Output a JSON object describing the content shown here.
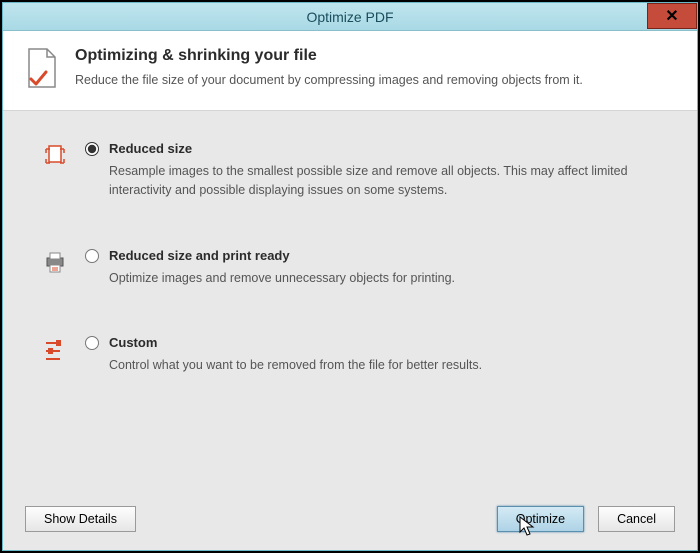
{
  "window": {
    "title": "Optimize PDF"
  },
  "header": {
    "heading": "Optimizing & shrinking your file",
    "sub": "Reduce the file size of your document by compressing images and removing objects from it."
  },
  "options": {
    "reduced": {
      "label": "Reduced size",
      "desc": "Resample images to the smallest possible size and remove all objects. This may affect limited interactivity and possible displaying issues on some systems.",
      "selected": true
    },
    "print": {
      "label": "Reduced size and print ready",
      "desc": "Optimize images and remove unnecessary objects for printing.",
      "selected": false
    },
    "custom": {
      "label": "Custom",
      "desc": "Control what you want to be removed from the file for better results.",
      "selected": false
    }
  },
  "footer": {
    "show_details": "Show Details",
    "optimize": "Optimize",
    "cancel": "Cancel"
  }
}
